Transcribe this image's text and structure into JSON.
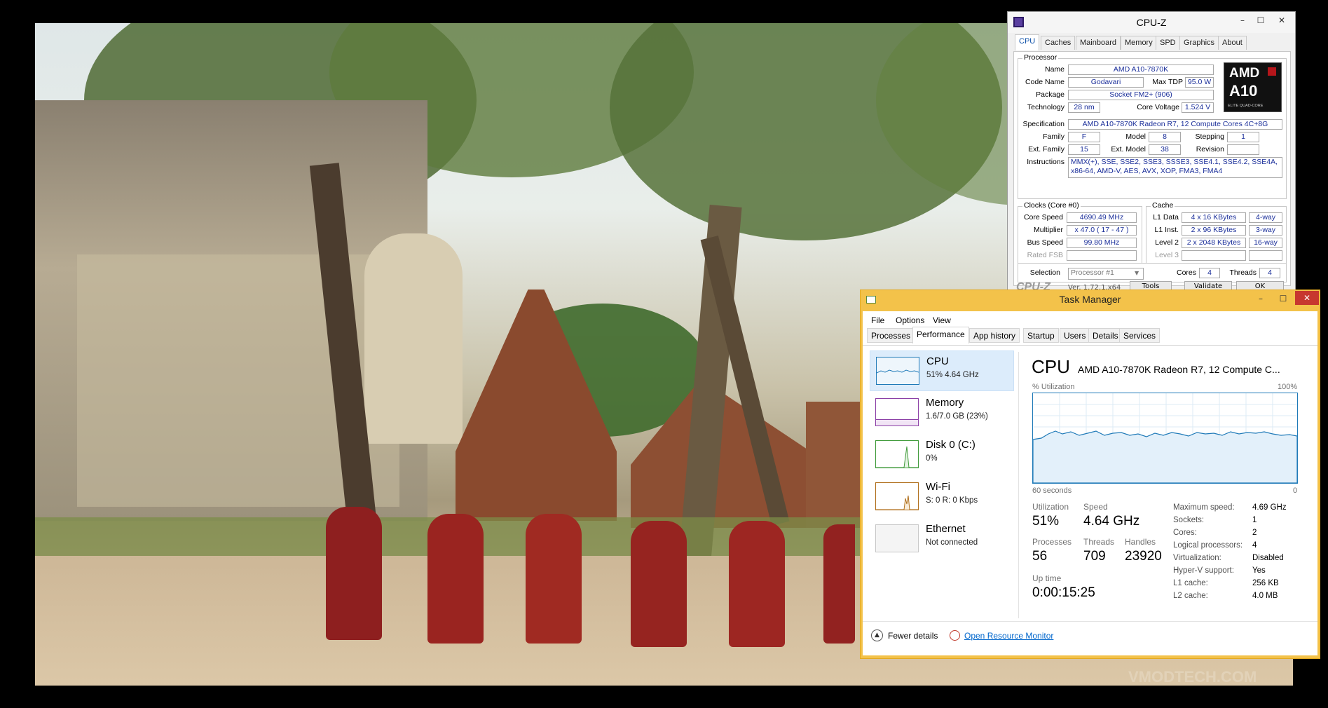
{
  "desktop": {
    "watermark": "VMODTECH.COM"
  },
  "cpuz": {
    "title": "CPU-Z",
    "tabs": [
      "CPU",
      "Caches",
      "Mainboard",
      "Memory",
      "SPD",
      "Graphics",
      "About"
    ],
    "processor": {
      "group_label": "Processor",
      "name_label": "Name",
      "name": "AMD A10-7870K",
      "codename_label": "Code Name",
      "codename": "Godavari",
      "maxtdp_label": "Max TDP",
      "maxtdp": "95.0 W",
      "package_label": "Package",
      "package": "Socket FM2+ (906)",
      "technology_label": "Technology",
      "technology": "28 nm",
      "corevoltage_label": "Core Voltage",
      "corevoltage": "1.524 V",
      "spec_label": "Specification",
      "spec": "AMD A10-7870K Radeon R7, 12 Compute Cores 4C+8G",
      "family_label": "Family",
      "family": "F",
      "model_label": "Model",
      "model": "8",
      "stepping_label": "Stepping",
      "stepping": "1",
      "extfamily_label": "Ext. Family",
      "extfamily": "15",
      "extmodel_label": "Ext. Model",
      "extmodel": "38",
      "revision_label": "Revision",
      "revision": "",
      "instructions_label": "Instructions",
      "instructions": "MMX(+), SSE, SSE2, SSE3, SSSE3, SSE4.1, SSE4.2, SSE4A, x86-64, AMD-V, AES, AVX, XOP, FMA3, FMA4",
      "logo_brand": "AMD",
      "logo_model": "A10",
      "logo_sub": "ELITE QUAD-CORE"
    },
    "clocks": {
      "group_label": "Clocks (Core #0)",
      "corespeed_label": "Core Speed",
      "corespeed": "4690.49 MHz",
      "multiplier_label": "Multiplier",
      "multiplier": "x 47.0 ( 17 - 47 )",
      "busspeed_label": "Bus Speed",
      "busspeed": "99.80 MHz",
      "ratedfsb_label": "Rated FSB",
      "ratedfsb": ""
    },
    "cache": {
      "group_label": "Cache",
      "l1data_label": "L1 Data",
      "l1data": "4 x 16 KBytes",
      "l1data_way": "4-way",
      "l1inst_label": "L1 Inst.",
      "l1inst": "2 x 96 KBytes",
      "l1inst_way": "3-way",
      "l2_label": "Level 2",
      "l2": "2 x 2048 KBytes",
      "l2_way": "16-way",
      "l3_label": "Level 3",
      "l3": "",
      "l3_way": ""
    },
    "selection": {
      "label": "Selection",
      "value": "Processor #1",
      "cores_label": "Cores",
      "cores": "4",
      "threads_label": "Threads",
      "threads": "4"
    },
    "footer": {
      "brand": "CPU-Z",
      "version": "Ver. 1.72.1.x64",
      "tools": "Tools",
      "validate": "Validate",
      "ok": "OK"
    }
  },
  "taskmgr": {
    "title": "Task Manager",
    "menu": [
      "File",
      "Options",
      "View"
    ],
    "tabs": [
      "Processes",
      "Performance",
      "App history",
      "Startup",
      "Users",
      "Details",
      "Services"
    ],
    "sidebar": [
      {
        "name": "CPU",
        "sub": "51% 4.64 GHz"
      },
      {
        "name": "Memory",
        "sub": "1.6/7.0 GB (23%)"
      },
      {
        "name": "Disk 0 (C:)",
        "sub": "0%"
      },
      {
        "name": "Wi-Fi",
        "sub": "S: 0 R: 0 Kbps"
      },
      {
        "name": "Ethernet",
        "sub": "Not connected"
      }
    ],
    "main": {
      "heading": "CPU",
      "cpu_name": "AMD A10-7870K Radeon R7, 12 Compute C...",
      "graph_label": "% Utilization",
      "graph_max": "100%",
      "graph_time": "60 seconds",
      "graph_min": "0",
      "utilization_label": "Utilization",
      "utilization": "51%",
      "speed_label": "Speed",
      "speed": "4.64 GHz",
      "processes_label": "Processes",
      "processes": "56",
      "threads_label": "Threads",
      "threads": "709",
      "handles_label": "Handles",
      "handles": "23920",
      "uptime_label": "Up time",
      "uptime": "0:00:15:25",
      "specs": [
        {
          "label": "Maximum speed:",
          "value": "4.69 GHz"
        },
        {
          "label": "Sockets:",
          "value": "1"
        },
        {
          "label": "Cores:",
          "value": "2"
        },
        {
          "label": "Logical processors:",
          "value": "4"
        },
        {
          "label": "Virtualization:",
          "value": "Disabled"
        },
        {
          "label": "Hyper-V support:",
          "value": "Yes"
        },
        {
          "label": "L1 cache:",
          "value": "256 KB"
        },
        {
          "label": "L2 cache:",
          "value": "4.0 MB"
        }
      ]
    },
    "footer": {
      "fewer_details": "Fewer details",
      "open_monitor": "Open Resource Monitor"
    },
    "colors": {
      "frame": "#f3c24a",
      "graph_line": "#1f7ab8",
      "graph_fill": "#dcedf8",
      "memory_accent": "#8b3fa6",
      "disk_accent": "#3f9a3a",
      "wifi_accent": "#b06f1b",
      "link": "#0066cc"
    }
  }
}
